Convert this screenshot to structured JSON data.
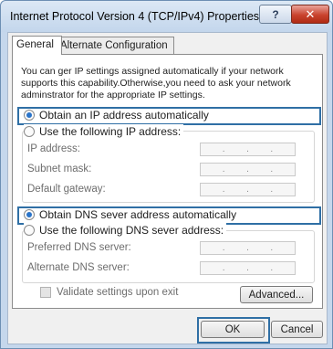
{
  "window": {
    "title": "Internet Protocol Version 4 (TCP/IPv4) Properties",
    "help_label": "?",
    "close_label": "✕"
  },
  "tabs": [
    {
      "label": "General",
      "active": true
    },
    {
      "label": "Alternate Configuration",
      "active": false
    }
  ],
  "info_text": "You can ger IP settings assigned automatically if your network supports this capability.Otherwise,you need to ask your network adminstrator for the appropriate IP settings.",
  "ip_section": {
    "auto_label": "Obtain an IP address automatically",
    "auto_selected": true,
    "manual_label": "Use the following IP address:",
    "manual_selected": false,
    "fields": [
      {
        "label": "IP address:",
        "value": ". . ."
      },
      {
        "label": "Subnet mask:",
        "value": ". . ."
      },
      {
        "label": "Default gateway:",
        "value": ". . ."
      }
    ]
  },
  "dns_section": {
    "auto_label": "Obtain DNS sever address automatically",
    "auto_selected": true,
    "manual_label": "Use the following DNS sever address:",
    "manual_selected": false,
    "fields": [
      {
        "label": "Preferred DNS server:",
        "value": ". . ."
      },
      {
        "label": "Alternate DNS server:",
        "value": ". . ."
      }
    ]
  },
  "validate_label": "Validate settings upon exit",
  "buttons": {
    "advanced": "Advanced...",
    "ok": "OK",
    "cancel": "Cancel"
  },
  "colors": {
    "highlight": "#2f6fa5",
    "radio_selected": "#2a74c9",
    "title_bar": "#c3d6ec"
  }
}
